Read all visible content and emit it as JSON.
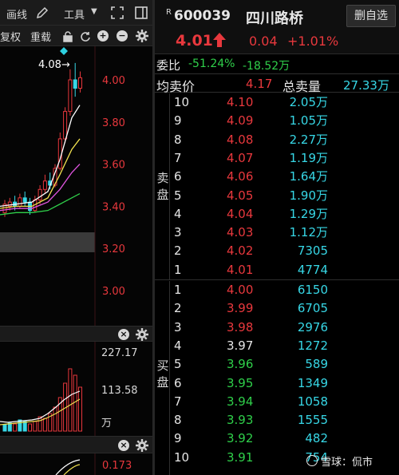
{
  "toolbar": {
    "draw_label": "画线",
    "tools_label": "工具",
    "adjust_label": "复权",
    "reload_label": "重载"
  },
  "kline": {
    "max_marker": "4.08→",
    "y_ticks": [
      "4.00",
      "3.80",
      "3.60",
      "3.40",
      "3.20",
      "3.00"
    ]
  },
  "volume": {
    "y_ticks": [
      "227.17",
      "113.58"
    ],
    "unit": "万"
  },
  "indicator": {
    "y_tick": "0.173"
  },
  "stock": {
    "badge": "R",
    "code": "600039",
    "name": "四川路桥",
    "price": "4.01",
    "change": "0.04",
    "change_pct": "+1.01%",
    "add_watch_label": "删自选"
  },
  "ratio": {
    "label": "委比",
    "value": "-51.24%",
    "diff": "-18.52万"
  },
  "avg": {
    "avg_label": "均卖价",
    "avg_value": "4.17",
    "total_label": "总卖量",
    "total_value": "27.33万"
  },
  "sell": {
    "side_label_1": "卖",
    "side_label_2": "盘",
    "rows": [
      {
        "level": "10",
        "price": "4.10",
        "volume": "2.05万"
      },
      {
        "level": "9",
        "price": "4.09",
        "volume": "1.05万"
      },
      {
        "level": "8",
        "price": "4.08",
        "volume": "2.27万"
      },
      {
        "level": "7",
        "price": "4.07",
        "volume": "1.19万"
      },
      {
        "level": "6",
        "price": "4.06",
        "volume": "1.64万"
      },
      {
        "level": "5",
        "price": "4.05",
        "volume": "1.90万"
      },
      {
        "level": "4",
        "price": "4.04",
        "volume": "1.29万"
      },
      {
        "level": "3",
        "price": "4.03",
        "volume": "1.12万"
      },
      {
        "level": "2",
        "price": "4.02",
        "volume": "7305"
      },
      {
        "level": "1",
        "price": "4.01",
        "volume": "4774"
      }
    ]
  },
  "buy": {
    "side_label_1": "买",
    "side_label_2": "盘",
    "rows": [
      {
        "level": "1",
        "price": "4.00",
        "volume": "6150",
        "tone": "red"
      },
      {
        "level": "2",
        "price": "3.99",
        "volume": "6705",
        "tone": "red"
      },
      {
        "level": "3",
        "price": "3.98",
        "volume": "2976",
        "tone": "red"
      },
      {
        "level": "4",
        "price": "3.97",
        "volume": "1272",
        "tone": "white"
      },
      {
        "level": "5",
        "price": "3.96",
        "volume": "589",
        "tone": "green"
      },
      {
        "level": "6",
        "price": "3.95",
        "volume": "1349",
        "tone": "green"
      },
      {
        "level": "7",
        "price": "3.94",
        "volume": "1058",
        "tone": "green"
      },
      {
        "level": "8",
        "price": "3.93",
        "volume": "1555",
        "tone": "green"
      },
      {
        "level": "9",
        "price": "3.92",
        "volume": "482",
        "tone": "green"
      },
      {
        "level": "10",
        "price": "3.91",
        "volume": "754",
        "tone": "green"
      }
    ]
  },
  "watermark": "雪球：侃市",
  "colors": {
    "up": "#e8383d",
    "down": "#2fcf4a",
    "volume": "#37d7e6"
  }
}
